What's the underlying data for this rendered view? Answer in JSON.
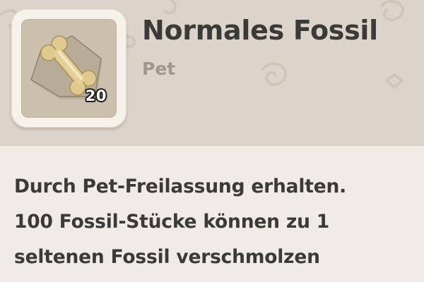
{
  "item": {
    "name": "Normales Fossil",
    "type": "Pet",
    "count": "20",
    "icon": "bone-fossil-icon"
  },
  "description": {
    "lines": [
      "Durch Pet-Freilassung erhalten.",
      "100 Fossil-Stücke können zu 1",
      "seltenen Fossil verschmolzen"
    ]
  },
  "colors": {
    "header_bg": "#dcd3cb",
    "body_bg": "#f0ebe6",
    "title_text": "#3a3a38",
    "subtitle_text": "#a2968b"
  }
}
